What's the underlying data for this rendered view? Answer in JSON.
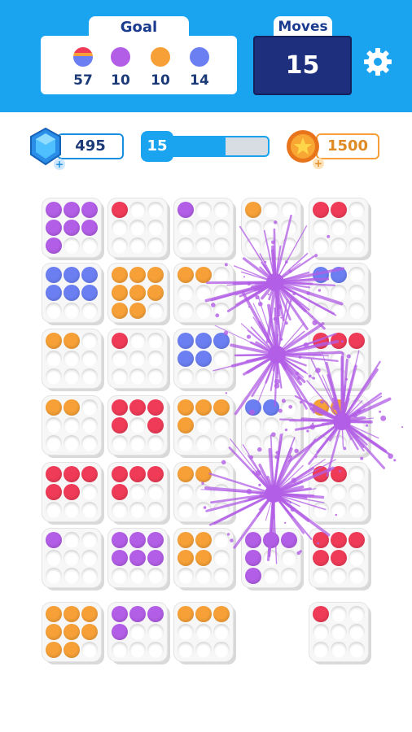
{
  "header": {
    "goal_label": "Goal",
    "moves_label": "Moves",
    "moves_value": "15",
    "goals": [
      {
        "icon": "striped-ball-icon",
        "color": "multi",
        "count": "57"
      },
      {
        "icon": "purple-ball-icon",
        "color": "#b25ee6",
        "count": "10"
      },
      {
        "icon": "orange-ball-icon",
        "color": "#f6a037",
        "count": "10"
      },
      {
        "icon": "blue-ball-icon",
        "color": "#6b7ff2",
        "count": "14"
      }
    ]
  },
  "stats": {
    "gems": "495",
    "level": "15",
    "level_progress": 0.6,
    "coins": "1500"
  },
  "colors": {
    "purple": "#b25ee6",
    "red": "#ef3b57",
    "blue": "#6b7ff2",
    "orange": "#f6a037",
    "accent": "#1aa3ee"
  },
  "board": {
    "tiles": [
      [
        [
          "P",
          "P",
          "P",
          "P",
          "P",
          "P",
          "P",
          "",
          ""
        ],
        [
          "R",
          "",
          "",
          "",
          "",
          "",
          "",
          "",
          ""
        ],
        [
          "P",
          "",
          "",
          "",
          "",
          "",
          "",
          "",
          ""
        ],
        [
          "O",
          "",
          "",
          "",
          "",
          "",
          "",
          "",
          ""
        ],
        [
          "R",
          "R",
          "",
          "",
          "",
          "",
          "",
          "",
          ""
        ]
      ],
      [
        [
          "B",
          "B",
          "B",
          "B",
          "B",
          "B",
          "",
          "",
          ""
        ],
        [
          "O",
          "O",
          "O",
          "O",
          "O",
          "O",
          "O",
          "O",
          ""
        ],
        [
          "O",
          "O",
          "",
          "",
          "",
          "",
          "",
          "",
          ""
        ],
        null,
        [
          "B",
          "B",
          "",
          "",
          "",
          "",
          "",
          "",
          ""
        ]
      ],
      [
        [
          "O",
          "O",
          "",
          "",
          "",
          "",
          "",
          "",
          ""
        ],
        [
          "R",
          "",
          "",
          "",
          "",
          "",
          "",
          "",
          ""
        ],
        [
          "B",
          "B",
          "B",
          "B",
          "B",
          "",
          "",
          "",
          ""
        ],
        null,
        [
          "R",
          "R",
          "R",
          "",
          "",
          "",
          "",
          "",
          ""
        ]
      ],
      [
        [
          "O",
          "O",
          "",
          "",
          "",
          "",
          "",
          "",
          ""
        ],
        [
          "R",
          "R",
          "R",
          "R",
          "",
          "R",
          "",
          "",
          ""
        ],
        [
          "O",
          "O",
          "O",
          "O",
          "",
          "",
          "",
          "",
          ""
        ],
        [
          "B",
          "B",
          "",
          "",
          "",
          "",
          "",
          "",
          ""
        ],
        [
          "O",
          "O",
          "",
          "",
          "",
          "",
          "",
          "",
          ""
        ]
      ],
      [
        [
          "R",
          "R",
          "R",
          "R",
          "R",
          "",
          "",
          "",
          ""
        ],
        [
          "R",
          "R",
          "R",
          "R",
          "",
          "",
          "",
          "",
          ""
        ],
        [
          "O",
          "O",
          "",
          "",
          "",
          "",
          "",
          "",
          ""
        ],
        null,
        [
          "R",
          "R",
          "",
          "",
          "",
          "",
          "",
          "",
          ""
        ]
      ],
      [
        [
          "P",
          "",
          "",
          "",
          "",
          "",
          "",
          "",
          ""
        ],
        [
          "P",
          "P",
          "P",
          "P",
          "P",
          "P",
          "",
          "",
          ""
        ],
        [
          "O",
          "O",
          "",
          "O",
          "O",
          "",
          "",
          "",
          ""
        ],
        [
          "P",
          "P",
          "P",
          "P",
          "",
          "",
          "P",
          "",
          ""
        ],
        [
          "R",
          "R",
          "R",
          "R",
          "R",
          "",
          "",
          "",
          ""
        ]
      ],
      [
        [
          "O",
          "O",
          "O",
          "O",
          "O",
          "O",
          "O",
          "O",
          ""
        ],
        [
          "P",
          "P",
          "P",
          "P",
          "",
          "",
          "",
          "",
          ""
        ],
        [
          "O",
          "O",
          "O",
          "",
          "",
          "",
          "",
          "",
          ""
        ],
        null,
        [
          "R",
          "",
          "",
          "",
          "",
          "",
          "",
          "",
          ""
        ]
      ]
    ]
  }
}
